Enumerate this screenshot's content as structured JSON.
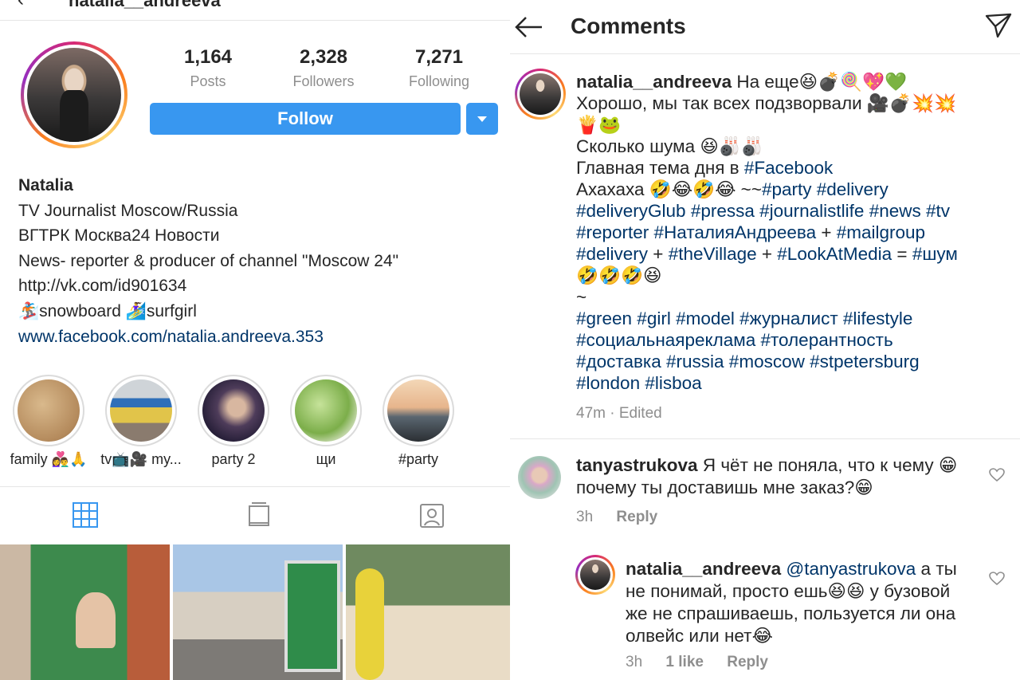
{
  "profile": {
    "username": "natalia__andreeva",
    "stats": [
      {
        "value": "1,164",
        "label": "Posts"
      },
      {
        "value": "2,328",
        "label": "Followers"
      },
      {
        "value": "7,271",
        "label": "Following"
      }
    ],
    "follow_label": "Follow",
    "bio": {
      "name": "Natalia",
      "lines": [
        "TV Journalist Moscow/Russia",
        "ВГТРК Москва24 Новости",
        "News- reporter & producer of channel \"Moscow 24\"",
        "http://vk.com/id901634",
        "🏂snowboard 🏄‍♀️surfgirl"
      ],
      "link": "www.facebook.com/natalia.andreeva.353"
    },
    "highlights": [
      {
        "label": "family 👩‍❤️‍👨🙏"
      },
      {
        "label": "tv📺🎥 my..."
      },
      {
        "label": "party 2"
      },
      {
        "label": "щи"
      },
      {
        "label": "#party"
      }
    ],
    "tabs": [
      "grid-icon",
      "igtv-icon",
      "tagged-icon"
    ]
  },
  "comments_screen": {
    "title": "Comments",
    "caption": {
      "user": "natalia__andreeva",
      "line1": " На еще😆💣🍭💖💚",
      "line2": "Хорошо, мы так всех подзворвали 🎥💣💥💥",
      "line3": "🍟🐸",
      "line4": "Сколько шума 😆🎳🎳",
      "line5_text": "Главная тема дня в ",
      "line5_tag": "#Facebook",
      "line6_text": "Ахахаха 🤣😂🤣😂 ~~",
      "line6_tags": "#party #delivery",
      "line7": "#deliveryGlub #pressa #journalistlife #news #tv",
      "line8a": "#reporter  #НаталияАндреева",
      "line8b": " + ",
      "line8c": "#mailgroup",
      "line9a": "#delivery",
      "line9b": " + ",
      "line9c": "#theVillage",
      "line9d": " +  ",
      "line9e": "#LookAtMedia",
      "line9f": " = ",
      "line9g": "#шум",
      "line10": "🤣🤣🤣😆",
      "line11": "~",
      "line12": "#green #girl #model #журналист #lifestyle",
      "line13": "#социальнаяреклама #толерантность",
      "line14": "#доставка #russia #moscow #stpetersburg",
      "line15": "#london #lisboa",
      "meta": "47m · Edited"
    },
    "comment1": {
      "user": "tanyastrukova",
      "text1": " Я чёт не поняла, что к чему 😁",
      "text2": "почему ты доставишь мне заказ?😁",
      "time": "3h",
      "reply": "Reply"
    },
    "comment2": {
      "user": "natalia__andreeva",
      "mention": " @tanyastrukova",
      "text1": " а ты",
      "text2": "не понимай, просто ешь😆😆 у бузовой",
      "text3": "же не спрашиваешь, пользуется ли она",
      "text4": "олвейс или нет😂",
      "time": "3h",
      "likes": "1 like",
      "reply": "Reply"
    }
  }
}
